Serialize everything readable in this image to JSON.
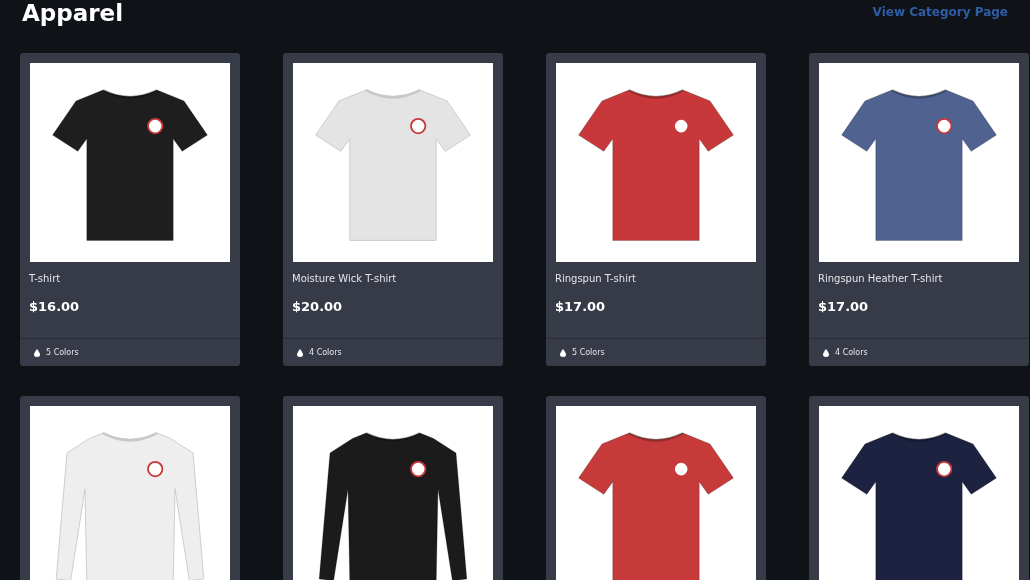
{
  "header": {
    "title": "Apparel",
    "link": "View Category Page"
  },
  "products": [
    {
      "name": "T-shirt",
      "price": "$16.00",
      "colors": "5 Colors",
      "color": "#1e1e1e",
      "kind": "short"
    },
    {
      "name": "Moisture Wick T-shirt",
      "price": "$20.00",
      "colors": "4 Colors",
      "color": "#e4e4e4",
      "kind": "short"
    },
    {
      "name": "Ringspun T-shirt",
      "price": "$17.00",
      "colors": "5 Colors",
      "color": "#c8383a",
      "kind": "short"
    },
    {
      "name": "Ringspun Heather T-shirt",
      "price": "$17.00",
      "colors": "4 Colors",
      "color": "#4f6290",
      "kind": "short"
    },
    {
      "color": "#eeeeee",
      "kind": "long"
    },
    {
      "color": "#1b1b1b",
      "kind": "long"
    },
    {
      "color": "#c63a3a",
      "kind": "short"
    },
    {
      "color": "#1c2240",
      "kind": "short"
    }
  ]
}
